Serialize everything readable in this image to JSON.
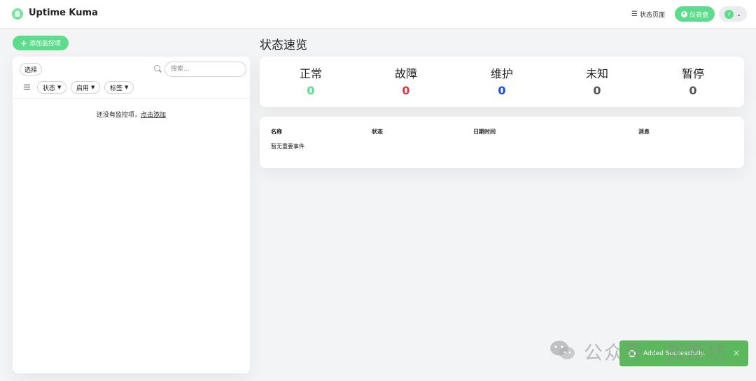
{
  "header": {
    "app_title": "Uptime Kuma",
    "status_page_label": "状态页面",
    "dashboard_label": "仪表盘",
    "avatar_initial": "z"
  },
  "sidebar": {
    "add_monitor_label": "添加监控项",
    "select_label": "选择",
    "search_placeholder": "搜索...",
    "filters": [
      {
        "label": "状态"
      },
      {
        "label": "启用"
      },
      {
        "label": "标签"
      }
    ],
    "empty_text": "还没有监控项，",
    "empty_link": "点击添加"
  },
  "main": {
    "title": "状态速览",
    "stats": [
      {
        "label": "正常",
        "value": "0",
        "color": "#5cdd8b"
      },
      {
        "label": "故障",
        "value": "0",
        "color": "#dc3545"
      },
      {
        "label": "维护",
        "value": "0",
        "color": "#1747f5"
      },
      {
        "label": "未知",
        "value": "0",
        "color": "#555555"
      },
      {
        "label": "暂停",
        "value": "0",
        "color": "#555555"
      }
    ],
    "events": {
      "columns": [
        "名称",
        "状态",
        "日期时间",
        "消息"
      ],
      "empty": "暂无重要事件"
    }
  },
  "toast": {
    "message": "Added Successfully.",
    "close_label": "×",
    "color": "#5cb85c"
  },
  "watermark": {
    "text": "公众号 · 知新坊"
  },
  "colors": {
    "accent": "#5cdd8b"
  }
}
